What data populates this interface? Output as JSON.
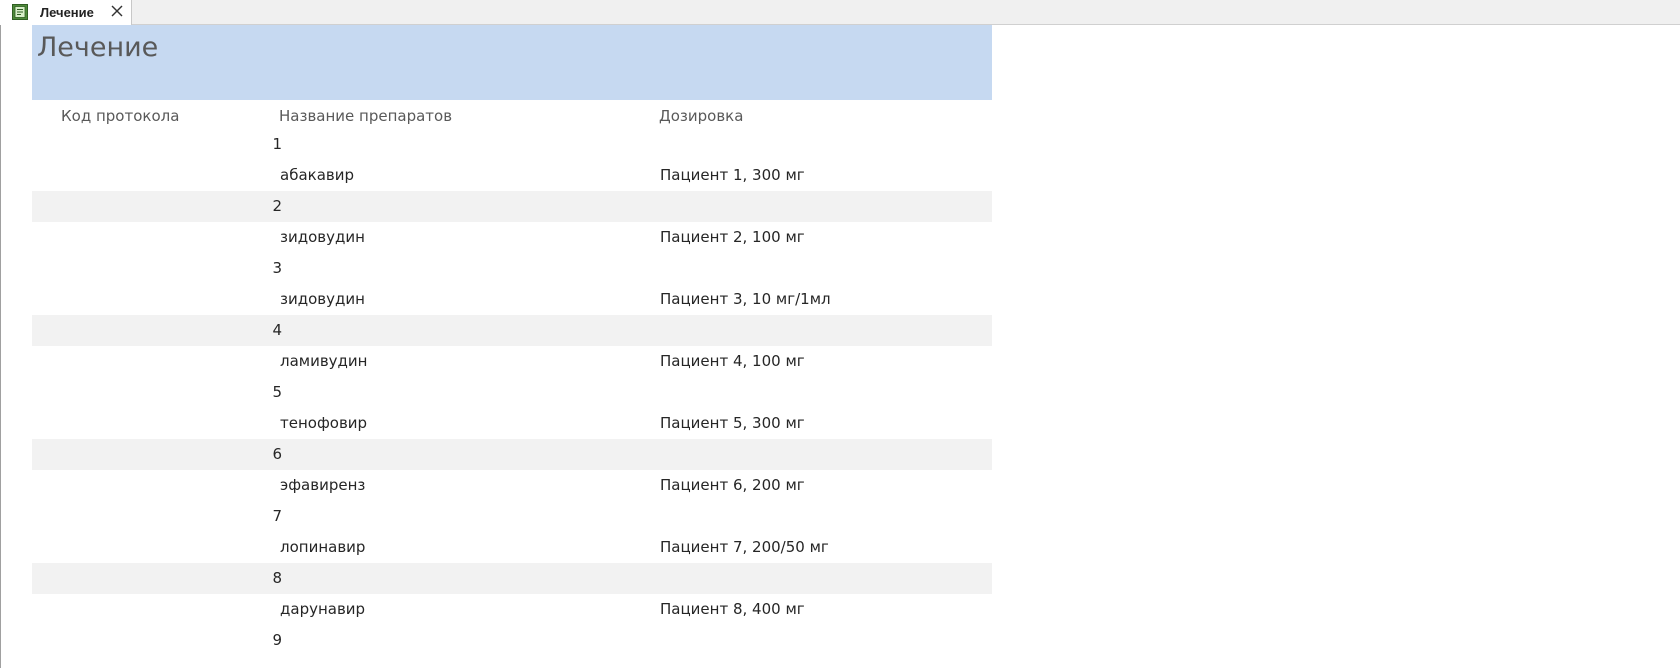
{
  "tab": {
    "label": "Лечение",
    "icon": "report-icon",
    "close_icon": "close-icon"
  },
  "report": {
    "title": "Лечение",
    "columns": {
      "code": "Код протокола",
      "drug": "Название препаратов",
      "dose": "Дозировка"
    },
    "rows": [
      {
        "code": "1",
        "drug": "",
        "dose": ""
      },
      {
        "code": "",
        "drug": "абакавир",
        "dose": "Пациент 1, 300 мг"
      },
      {
        "code": "2",
        "drug": "",
        "dose": ""
      },
      {
        "code": "",
        "drug": "зидовудин",
        "dose": "Пациент 2, 100 мг"
      },
      {
        "code": "3",
        "drug": "",
        "dose": ""
      },
      {
        "code": "",
        "drug": "зидовудин",
        "dose": "Пациент 3, 10 мг/1мл"
      },
      {
        "code": "4",
        "drug": "",
        "dose": ""
      },
      {
        "code": "",
        "drug": "ламивудин",
        "dose": "Пациент 4, 100 мг"
      },
      {
        "code": "5",
        "drug": "",
        "dose": ""
      },
      {
        "code": "",
        "drug": "тенофовир",
        "dose": "Пациент 5, 300 мг"
      },
      {
        "code": "6",
        "drug": "",
        "dose": ""
      },
      {
        "code": "",
        "drug": "эфавиренз",
        "dose": "Пациент 6, 200 мг"
      },
      {
        "code": "7",
        "drug": "",
        "dose": ""
      },
      {
        "code": "",
        "drug": "лопинавир",
        "dose": "Пациент 7, 200/50 мг"
      },
      {
        "code": "8",
        "drug": "",
        "dose": ""
      },
      {
        "code": "",
        "drug": "дарунавир",
        "dose": "Пациент 8, 400 мг"
      },
      {
        "code": "9",
        "drug": "",
        "dose": ""
      }
    ]
  },
  "colors": {
    "header_band": "#c6d9f1",
    "alt_row": "#f2f2f2",
    "title_text": "#595959"
  }
}
